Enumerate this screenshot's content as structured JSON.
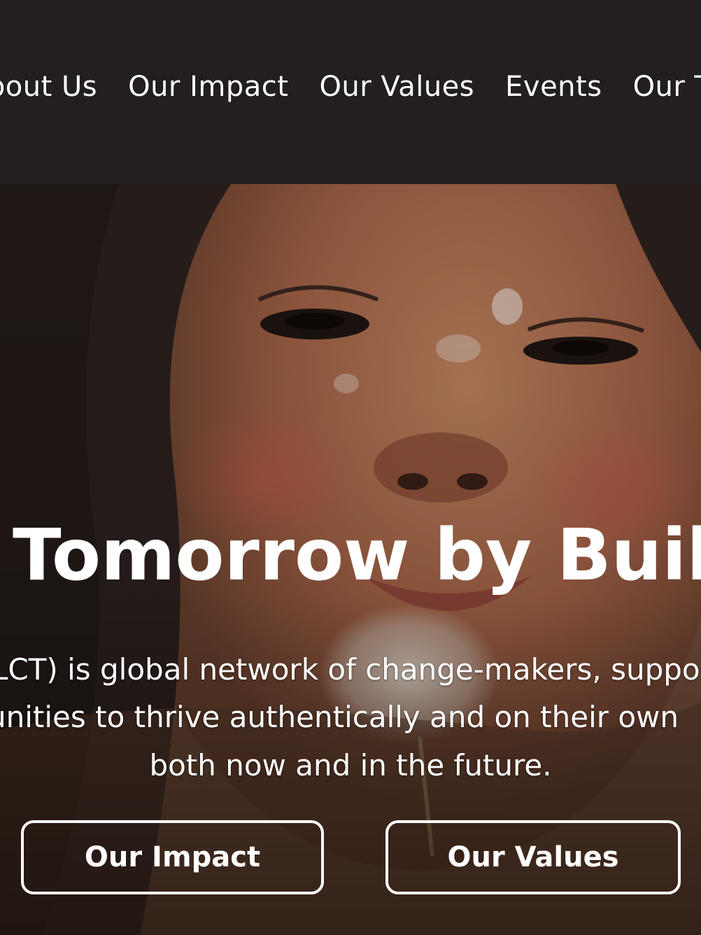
{
  "nav": {
    "items": [
      {
        "label": "About Us"
      },
      {
        "label": "Our Impact"
      },
      {
        "label": "Our Values"
      },
      {
        "label": "Events"
      },
      {
        "label": "Our Team"
      }
    ]
  },
  "hero": {
    "headline": "Tomorrow by Buil",
    "description_lines": [
      "LCT) is global network of change-makers, suppo",
      "unities to thrive authentically and on their own",
      "both now and in the future."
    ],
    "buttons": {
      "impact_label": "Our Impact",
      "values_label": "Our Values"
    }
  },
  "colors": {
    "nav_background": "#231f20",
    "text": "#ffffff"
  }
}
